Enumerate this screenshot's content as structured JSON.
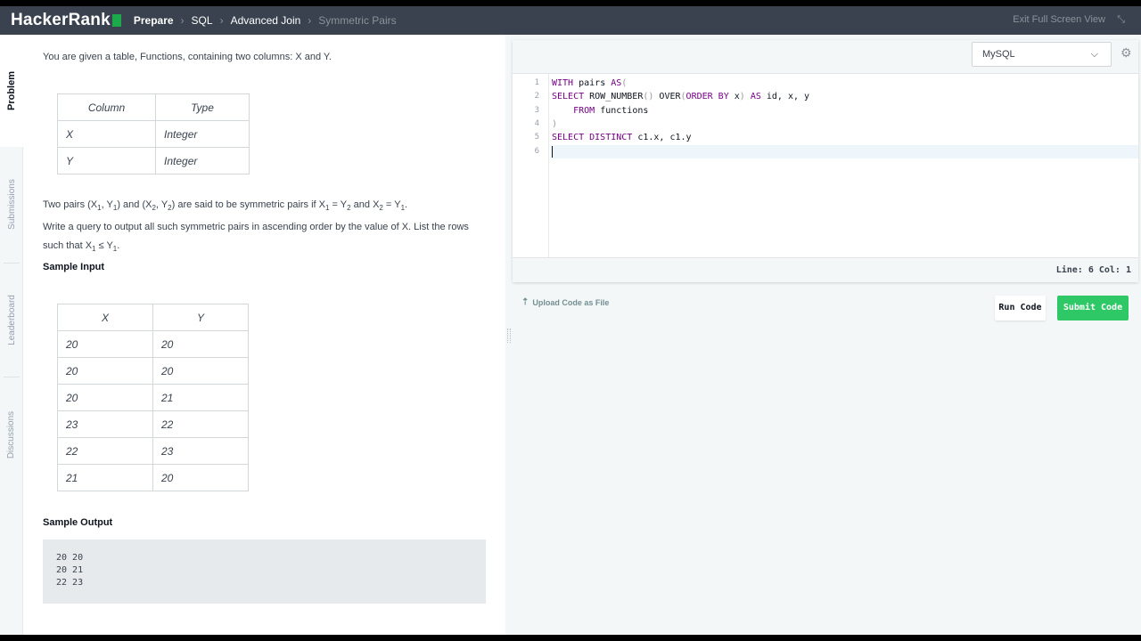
{
  "brand": "HackerRank",
  "breadcrumb": [
    "Prepare",
    "SQL",
    "Advanced Join",
    "Symmetric Pairs"
  ],
  "exit_fullscreen": "Exit Full Screen View",
  "left_tabs": [
    "Problem",
    "Submissions",
    "Leaderboard",
    "Discussions"
  ],
  "problem": {
    "intro": "You are given a table, Functions, containing two columns: X and Y.",
    "schema_headers": [
      "Column",
      "Type"
    ],
    "schema_rows": [
      [
        "X",
        "Integer"
      ],
      [
        "Y",
        "Integer"
      ]
    ],
    "desc_line1": {
      "a": "Two pairs (X",
      "s1": "1",
      "b": ", Y",
      "s2": "1",
      "c": ") and (X",
      "s3": "2",
      "d": ", Y",
      "s4": "2",
      "e": ") are said to be symmetric pairs if X",
      "s5": "1",
      "f": " = Y",
      "s6": "2",
      "g": " and X",
      "s7": "2",
      "h": " = Y",
      "s8": "1",
      "i": "."
    },
    "desc_line2": "Write a query to output all such symmetric pairs in ascending order by the value of X. List the rows",
    "desc_line3": {
      "a": "such that X",
      "s1": "1",
      "b": " ≤ Y",
      "s2": "1",
      "c": "."
    },
    "sample_input_label": "Sample Input",
    "sample_headers": [
      "X",
      "Y"
    ],
    "sample_rows": [
      [
        "20",
        "20"
      ],
      [
        "20",
        "20"
      ],
      [
        "20",
        "21"
      ],
      [
        "23",
        "22"
      ],
      [
        "22",
        "23"
      ],
      [
        "21",
        "20"
      ]
    ],
    "sample_output_label": "Sample Output",
    "sample_output": [
      "20 20",
      "20 21",
      "22 23"
    ]
  },
  "editor": {
    "language": "MySQL",
    "line_numbers": [
      "1",
      "2",
      "3",
      "4",
      "5",
      "6"
    ],
    "status": "Line: 6 Col: 1"
  },
  "actions": {
    "upload": "Upload Code as File",
    "run": "Run Code",
    "submit": "Submit Code"
  },
  "colors": {
    "topbar": "#39424e",
    "brand_accent": "#1ba94c",
    "submit": "#2ec866",
    "keyword": "#770088"
  }
}
